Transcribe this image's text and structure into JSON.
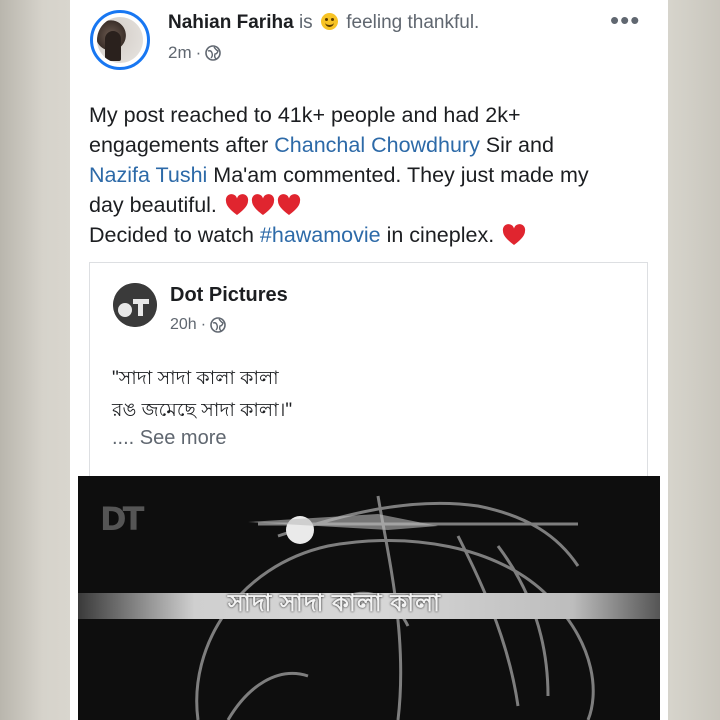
{
  "post": {
    "author": "Nahian Fariha",
    "is_word": "is",
    "feeling": "feeling thankful.",
    "time": "2m",
    "text": {
      "l1": "My post reached to 41k+ people and had 2k+",
      "l2a": "engagements after ",
      "mention1": "Chanchal Chowdhury",
      "l2b": " Sir and",
      "mention2": "Nazifa Tushi",
      "l3b": " Ma'am commented. They just made my",
      "l4": "day beautiful. ",
      "l5a": "Decided to watch ",
      "hashtag": "#hawamovie",
      "l5b": " in cineplex. "
    }
  },
  "shared_post": {
    "page_name": "Dot Pictures",
    "time": "20h",
    "quote_line1": "\"সাদা সাদা কালা কালা",
    "quote_line2": "রঙ জমেছে সাদা কালা।\"",
    "see_more": ".... See more",
    "video_caption": "সাদা সাদা কালা কালা",
    "video_logo": "DT"
  },
  "colors": {
    "link": "#2d6aa8",
    "heart": "#e0252f",
    "accent": "#1877f2"
  },
  "icons": [
    "globe-icon",
    "more-options-icon",
    "smiley-icon",
    "heart-icon"
  ]
}
